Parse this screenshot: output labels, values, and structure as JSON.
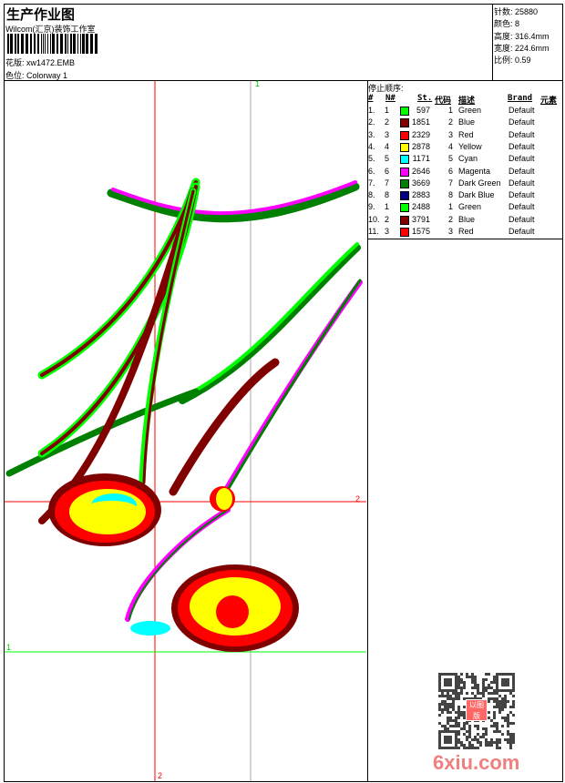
{
  "header": {
    "title": "生产作业图",
    "company": "Wilcom(汇京)装饰工作室",
    "design_label": "花版:",
    "design_file": "xw1472.EMB",
    "colorway_label": "色位:",
    "colorway": "Colorway 1"
  },
  "info": {
    "stitches": "针数: 25880",
    "colors": "颜色: 8",
    "height": "高度: 316.4mm",
    "width": "宽度: 224.6mm",
    "scale": "比例: 0.59"
  },
  "stop_sequence": {
    "title": "停止顺序:",
    "headers": [
      "#",
      "N#",
      "St.",
      "代码",
      "描述",
      "Brand",
      "元素"
    ],
    "rows": [
      {
        "idx": "1.",
        "n": "1",
        "color": "#00ff00",
        "st": "597",
        "code": "1",
        "desc": "Green",
        "brand": "Default"
      },
      {
        "idx": "2.",
        "n": "2",
        "color": "#800000",
        "st": "1851",
        "code": "2",
        "desc": "Blue",
        "brand": "Default"
      },
      {
        "idx": "3.",
        "n": "3",
        "color": "#ff0000",
        "st": "2329",
        "code": "3",
        "desc": "Red",
        "brand": "Default"
      },
      {
        "idx": "4.",
        "n": "4",
        "color": "#ffff00",
        "st": "2878",
        "code": "4",
        "desc": "Yellow",
        "brand": "Default"
      },
      {
        "idx": "5.",
        "n": "5",
        "color": "#00ffff",
        "st": "1171",
        "code": "5",
        "desc": "Cyan",
        "brand": "Default"
      },
      {
        "idx": "6.",
        "n": "6",
        "color": "#ff00ff",
        "st": "2646",
        "code": "6",
        "desc": "Magenta",
        "brand": "Default"
      },
      {
        "idx": "7.",
        "n": "7",
        "color": "#008000",
        "st": "3669",
        "code": "7",
        "desc": "Dark Green",
        "brand": "Default"
      },
      {
        "idx": "8.",
        "n": "8",
        "color": "#000080",
        "st": "2883",
        "code": "8",
        "desc": "Dark Blue",
        "brand": "Default"
      },
      {
        "idx": "9.",
        "n": "1",
        "color": "#00ff00",
        "st": "2488",
        "code": "1",
        "desc": "Green",
        "brand": "Default"
      },
      {
        "idx": "10.",
        "n": "2",
        "color": "#800000",
        "st": "3791",
        "code": "2",
        "desc": "Blue",
        "brand": "Default"
      },
      {
        "idx": "11.",
        "n": "3",
        "color": "#ff0000",
        "st": "1575",
        "code": "3",
        "desc": "Red",
        "brand": "Default"
      }
    ]
  },
  "guides": {
    "green_v": "1",
    "red_h": "2",
    "green_h": "1",
    "red_v": "2"
  },
  "watermark": {
    "text": "6xiu.com",
    "seal": "以图版"
  }
}
